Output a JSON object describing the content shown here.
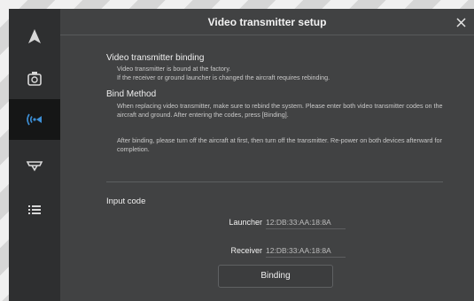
{
  "window": {
    "title": "Video transmitter setup"
  },
  "sidebar": {
    "items": [
      {
        "icon": "aircraft-arrow-icon",
        "active": false
      },
      {
        "icon": "gimbal-camera-icon",
        "active": false
      },
      {
        "icon": "video-transmitter-signal-icon",
        "active": true
      },
      {
        "icon": "remote-controller-icon",
        "active": false
      },
      {
        "icon": "menu-list-icon",
        "active": false
      }
    ]
  },
  "binding_section": {
    "title": "Video transmitter binding",
    "lines": [
      "Video transmitter is bound at the factory.",
      "If the receiver or ground launcher is changed the aircraft requires rebinding."
    ]
  },
  "bind_method": {
    "title": "Bind Method",
    "paragraph1": "When replacing video transmitter, make sure to rebind the system. Please enter both video transmitter codes on the aircraft and ground. After entering the codes, press [Binding].",
    "paragraph2": "After binding, please turn off the aircraft at first, then turn off the transmitter. Re-power on both devices afterward for completion."
  },
  "input_code": {
    "title": "Input code",
    "launcher": {
      "label": "Launcher",
      "value": "12:DB:33:AA:18:8A"
    },
    "receiver": {
      "label": "Receiver",
      "value": "12:DB:33:AA:18:8A"
    }
  },
  "binding_button": {
    "label": "Binding"
  },
  "colors": {
    "window_bg": "#414243",
    "sidebar_bg": "#2e2f30",
    "active_bg": "#151616",
    "accent": "#3d8fd6"
  }
}
